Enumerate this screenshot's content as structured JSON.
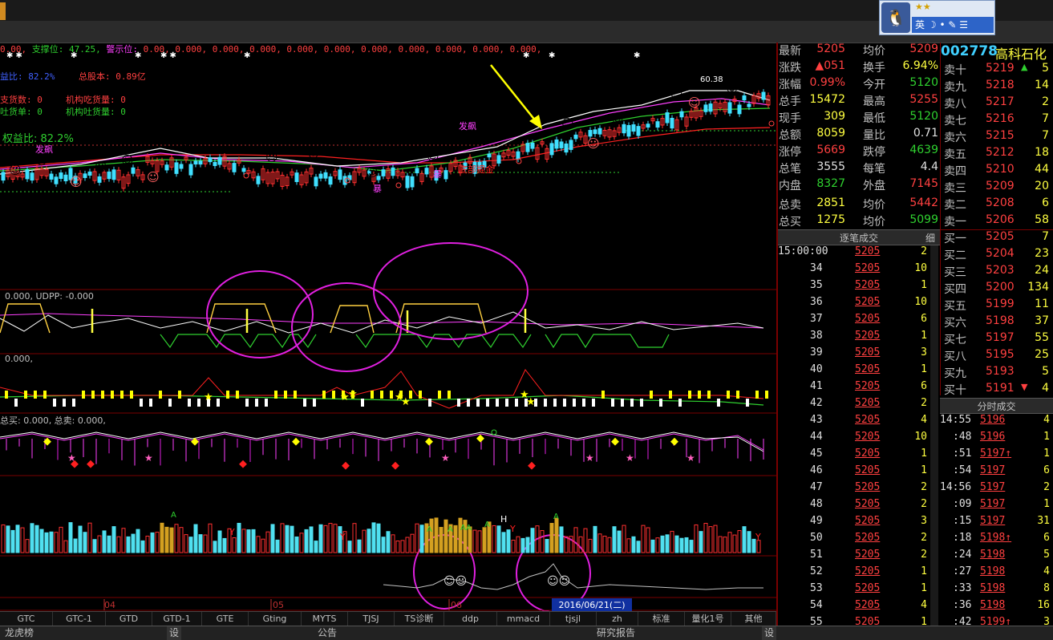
{
  "qq": {
    "input_mode": "英",
    "stars": "★★"
  },
  "header_info": {
    "line1_prefix": "0.00,",
    "support_label": "支撑位:",
    "support_value": "47.25,",
    "warn_label": "警示位:",
    "line1_rest": "0.00, 0.000, 0.000, 0.000, 0.000, 0.000, 0.000, 0.000, 0.000, 0.000, 0.000,",
    "ratio_short": "益比: 82.2%",
    "total_equity": "总股本: 0.89亿",
    "supply": "支货数: 0",
    "inst_buy": "机构吃货量: 0",
    "tu_huo": "吐货单: 0",
    "inst_spit": "机构吐货量: 0",
    "equity_ratio": "权益比: 82.2%"
  },
  "chart_labels": {
    "fa_biao_1": "发飙",
    "fa_biao_2": "发飙",
    "bao": "暴",
    "bao2": "暴",
    "jinghe": "底部掘金",
    "price_high": "60.38",
    "udpp": "0.000, UDPP: -0.000",
    "panel3": "0.000,",
    "total_buy": "总买: 0.000, 总卖: 0.000,",
    "month_04": "04",
    "month_05": "05",
    "month_06": "06",
    "date_cursor": "2016/06/21(二)"
  },
  "stock": {
    "code": "002778",
    "name": "高科石化"
  },
  "quote": [
    {
      "l1": "最新",
      "v1": "5205",
      "c1": "red",
      "l2": "均价",
      "v2": "5209",
      "c2": "red"
    },
    {
      "l1": "涨跌",
      "v1": "▲051",
      "c1": "red",
      "l2": "换手",
      "v2": "6.94%",
      "c2": "yellow"
    },
    {
      "l1": "涨幅",
      "v1": "0.99%",
      "c1": "red",
      "l2": "今开",
      "v2": "5120",
      "c2": "green"
    },
    {
      "l1": "总手",
      "v1": "15472",
      "c1": "yellow",
      "l2": "最高",
      "v2": "5255",
      "c2": "red"
    },
    {
      "l1": "现手",
      "v1": "309",
      "c1": "yellow",
      "l2": "最低",
      "v2": "5120",
      "c2": "green"
    },
    {
      "l1": "总额",
      "v1": "8059",
      "c1": "yellow",
      "l2": "量比",
      "v2": "0.71",
      "c2": "white"
    },
    {
      "l1": "涨停",
      "v1": "5669",
      "c1": "red",
      "l2": "跌停",
      "v2": "4639",
      "c2": "green"
    },
    {
      "l1": "总笔",
      "v1": "3555",
      "c1": "white",
      "l2": "每笔",
      "v2": "4.4",
      "c2": "white"
    },
    {
      "l1": "内盘",
      "v1": "8327",
      "c1": "green",
      "l2": "外盘",
      "v2": "7145",
      "c2": "red"
    },
    {
      "l1": "总卖",
      "v1": "2851",
      "c1": "yellow",
      "l2": "均价",
      "v2": "5442",
      "c2": "red"
    },
    {
      "l1": "总买",
      "v1": "1275",
      "c1": "yellow",
      "l2": "均价",
      "v2": "5099",
      "c2": "green"
    }
  ],
  "orderbook": [
    {
      "n": "卖十",
      "p": "5219",
      "v": "5",
      "mark": "▲"
    },
    {
      "n": "卖九",
      "p": "5218",
      "v": "14"
    },
    {
      "n": "卖八",
      "p": "5217",
      "v": "2"
    },
    {
      "n": "卖七",
      "p": "5216",
      "v": "7"
    },
    {
      "n": "卖六",
      "p": "5215",
      "v": "7"
    },
    {
      "n": "卖五",
      "p": "5212",
      "v": "18"
    },
    {
      "n": "卖四",
      "p": "5210",
      "v": "44"
    },
    {
      "n": "卖三",
      "p": "5209",
      "v": "20"
    },
    {
      "n": "卖二",
      "p": "5208",
      "v": "6"
    },
    {
      "n": "卖一",
      "p": "5206",
      "v": "58"
    },
    {
      "n": "买一",
      "p": "5205",
      "v": "7"
    },
    {
      "n": "买二",
      "p": "5204",
      "v": "23"
    },
    {
      "n": "买三",
      "p": "5203",
      "v": "24"
    },
    {
      "n": "买四",
      "p": "5200",
      "v": "134"
    },
    {
      "n": "买五",
      "p": "5199",
      "v": "11"
    },
    {
      "n": "买六",
      "p": "5198",
      "v": "37"
    },
    {
      "n": "买七",
      "p": "5197",
      "v": "55"
    },
    {
      "n": "买八",
      "p": "5195",
      "v": "25"
    },
    {
      "n": "买九",
      "p": "5193",
      "v": "5"
    },
    {
      "n": "买十",
      "p": "5191",
      "v": "4",
      "mark": "▼"
    }
  ],
  "trades_title": "逐笔成交",
  "trades_detail": "细",
  "trades": [
    {
      "t": "15:00:00",
      "p": "5205",
      "v": "2"
    },
    {
      "t": "34",
      "p": "5205",
      "v": "10"
    },
    {
      "t": "35",
      "p": "5205",
      "v": "1"
    },
    {
      "t": "36",
      "p": "5205",
      "v": "10"
    },
    {
      "t": "37",
      "p": "5205",
      "v": "6"
    },
    {
      "t": "38",
      "p": "5205",
      "v": "1"
    },
    {
      "t": "39",
      "p": "5205",
      "v": "3"
    },
    {
      "t": "40",
      "p": "5205",
      "v": "1"
    },
    {
      "t": "41",
      "p": "5205",
      "v": "6"
    },
    {
      "t": "42",
      "p": "5205",
      "v": "2"
    },
    {
      "t": "43",
      "p": "5205",
      "v": "4"
    },
    {
      "t": "44",
      "p": "5205",
      "v": "10"
    },
    {
      "t": "45",
      "p": "5205",
      "v": "1"
    },
    {
      "t": "46",
      "p": "5205",
      "v": "1"
    },
    {
      "t": "47",
      "p": "5205",
      "v": "2"
    },
    {
      "t": "48",
      "p": "5205",
      "v": "2"
    },
    {
      "t": "49",
      "p": "5205",
      "v": "3"
    },
    {
      "t": "50",
      "p": "5205",
      "v": "2"
    },
    {
      "t": "51",
      "p": "5205",
      "v": "2"
    },
    {
      "t": "52",
      "p": "5205",
      "v": "1"
    },
    {
      "t": "53",
      "p": "5205",
      "v": "1"
    },
    {
      "t": "54",
      "p": "5205",
      "v": "4"
    },
    {
      "t": "55",
      "p": "5205",
      "v": "1"
    }
  ],
  "minute_title": "分时成交",
  "minute": [
    {
      "t": "14:55",
      "p": "5196",
      "v": "4"
    },
    {
      "t": ":48",
      "p": "5196",
      "v": "1"
    },
    {
      "t": ":51",
      "p": "5197↑",
      "v": "1"
    },
    {
      "t": ":54",
      "p": "5197",
      "v": "6"
    },
    {
      "t": "14:56",
      "p": "5197",
      "v": "2"
    },
    {
      "t": ":09",
      "p": "5197",
      "v": "1"
    },
    {
      "t": ":15",
      "p": "5197",
      "v": "31"
    },
    {
      "t": ":18",
      "p": "5198↑",
      "v": "6"
    },
    {
      "t": ":24",
      "p": "5198",
      "v": "5"
    },
    {
      "t": ":27",
      "p": "5198",
      "v": "4"
    },
    {
      "t": ":33",
      "p": "5198",
      "v": "8"
    },
    {
      "t": ":36",
      "p": "5198",
      "v": "16"
    },
    {
      "t": ":42",
      "p": "5199↑",
      "v": "3"
    }
  ],
  "tabs": [
    "GTC",
    "GTC-1",
    "GTD",
    "GTD-1",
    "GTE",
    "Gting",
    "MYTS",
    "TJSJ",
    "TS诊断",
    "ddp",
    "mmacd",
    "tjsjl",
    "zh",
    "标准",
    "量化1号",
    "其他"
  ],
  "bottom": {
    "left": "龙虎榜",
    "set1": "设",
    "mid": "公告",
    "right": "研究报告",
    "set2": "设"
  }
}
